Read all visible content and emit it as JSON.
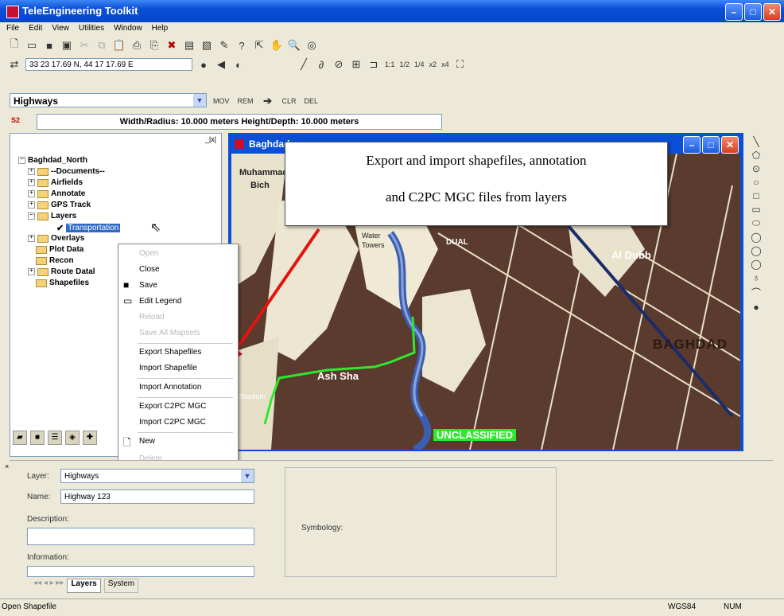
{
  "window": {
    "title": "TeleEngineering Toolkit"
  },
  "menu": [
    "File",
    "Edit",
    "View",
    "Utilities",
    "Window",
    "Help"
  ],
  "toolbar2": {
    "coordinates": "33 23 17.69 N, 44 17 17.69 E",
    "zoom_labels": [
      "1:1",
      "1/2",
      "1/4",
      "x2",
      "x4"
    ]
  },
  "layer_select": {
    "value": "Highways"
  },
  "toolbar3": {
    "buttons": [
      "MOV",
      "REM",
      "CLR",
      "DEL"
    ]
  },
  "status_field": {
    "value": "Width/Radius: 10.000 meters Height/Depth: 10.000 meters"
  },
  "tree": {
    "root": "Baghdad_North",
    "items": [
      "--Documents--",
      "Airfields",
      "Annotate",
      "GPS Track",
      "Layers",
      "Transportation",
      "Overlays",
      "Plot Data",
      "Recon",
      "Route Datal",
      "Shapefiles"
    ]
  },
  "map_window": {
    "title": "Baghdad",
    "labels": [
      "Muhammad",
      "Bich",
      "Water",
      "Towers",
      "DUAL",
      "Al Dubb",
      "BAGHDAD",
      "Ash Sha",
      "Stadium",
      "UNCLASSIFIED"
    ]
  },
  "callout": {
    "line1": "Export and import shapefiles, annotation",
    "line2": "and C2PC MGC files from layers"
  },
  "context_menu": {
    "items": [
      {
        "label": "Open",
        "enabled": false
      },
      {
        "label": "Close",
        "enabled": true
      },
      {
        "label": "Save",
        "enabled": true
      },
      {
        "label": "Edit Legend",
        "enabled": true
      },
      {
        "label": "Reload",
        "enabled": false
      },
      {
        "label": "Save All Mapsets",
        "enabled": false
      },
      {
        "label": "Export Shapefiles",
        "enabled": true
      },
      {
        "label": "Import Shapefile",
        "enabled": true
      },
      {
        "label": "Import Annotation",
        "enabled": true
      },
      {
        "label": "Export C2PC MGC",
        "enabled": true
      },
      {
        "label": "Import C2PC MGC",
        "enabled": true
      },
      {
        "label": "New",
        "enabled": true
      },
      {
        "label": "Delete",
        "enabled": false
      }
    ]
  },
  "bottom": {
    "layer_label": "Layer:",
    "layer_value": "Highways",
    "name_label": "Name:",
    "name_value": "Highway 123",
    "description_label": "Description:",
    "information_label": "Information:",
    "symbology_label": "Symbology:",
    "tabs": [
      "Layers",
      "System"
    ]
  },
  "statusbar": {
    "left": "Open Shapefile",
    "datum": "WGS84",
    "num": "NUM"
  },
  "colors": {
    "titlebar": "#0a4fd6",
    "map_bg": "#5a3b2e",
    "arrow": "#e3140f",
    "route": "#2ee82e"
  }
}
